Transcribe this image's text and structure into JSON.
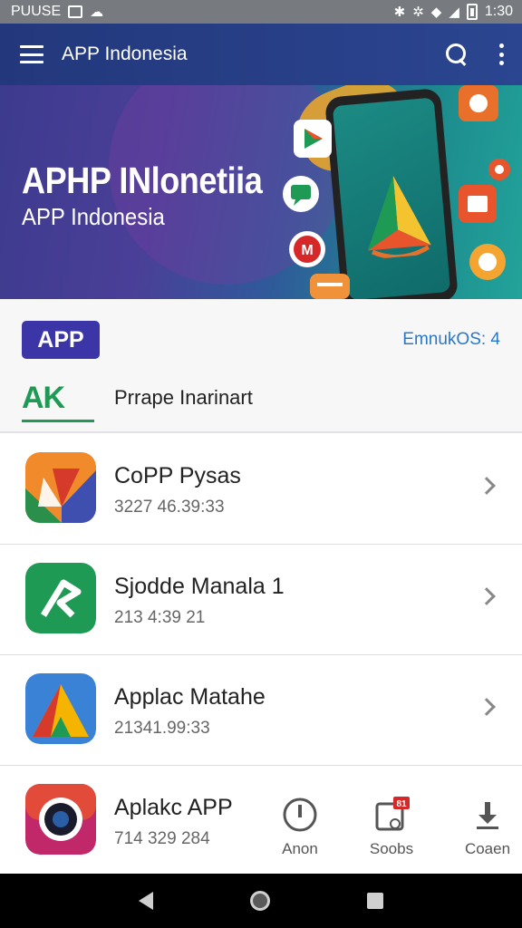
{
  "status_bar": {
    "carrier": "PUUSE",
    "time": "1:30"
  },
  "app_bar": {
    "title": "APP Indonesia",
    "menu_icon": "menu-icon",
    "search_icon": "search-icon",
    "more_icon": "more-vert-icon"
  },
  "banner": {
    "title": "APHP INlonetiia",
    "subtitle": "APP Indonesia"
  },
  "section": {
    "badge": "APP",
    "link": "EmnukOS: 4",
    "logo_text": "AK",
    "filter_label": "Prrape Inarinart"
  },
  "list": [
    {
      "title": "CoPP Pysas",
      "subtitle": "3227 46.39:33",
      "icon": "app-icon-orange"
    },
    {
      "title": "Sjodde Manala  1",
      "subtitle": "213 4:39 21",
      "icon": "app-icon-green"
    },
    {
      "title": "Applac Matahe",
      "subtitle": "21341.99:33",
      "icon": "app-icon-colorful"
    },
    {
      "title": "Aplakc APP",
      "subtitle": "714 329 284",
      "icon": "app-icon-camera"
    }
  ],
  "actions": [
    {
      "label": "Anon",
      "icon": "power-icon"
    },
    {
      "label": "Soobs",
      "icon": "device-badge-icon",
      "badge": "81"
    },
    {
      "label": "Coaen",
      "icon": "download-icon"
    }
  ],
  "colors": {
    "app_bar": "#23387c",
    "badge": "#3b35a8",
    "link": "#2a78c9",
    "accent_green": "#1f9a55"
  }
}
